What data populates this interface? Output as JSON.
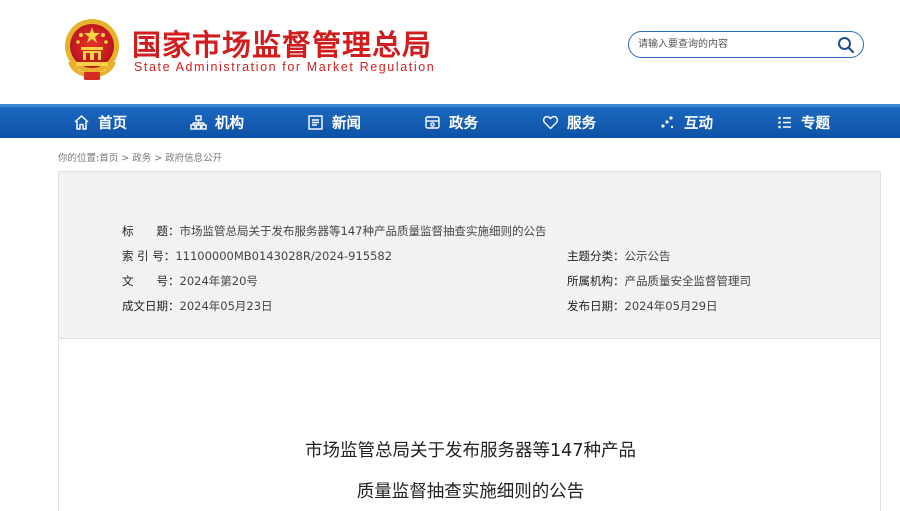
{
  "header": {
    "site_title": "国家市场监督管理总局",
    "site_subtitle": "State Administration for Market Regulation"
  },
  "search": {
    "placeholder": "请输入要查询的内容"
  },
  "nav": {
    "items": [
      {
        "label": "首页",
        "icon": "home-icon"
      },
      {
        "label": "机构",
        "icon": "organization-icon"
      },
      {
        "label": "新闻",
        "icon": "news-icon"
      },
      {
        "label": "政务",
        "icon": "government-affairs-icon"
      },
      {
        "label": "服务",
        "icon": "heart-icon"
      },
      {
        "label": "互动",
        "icon": "interaction-icon"
      },
      {
        "label": "专题",
        "icon": "topic-icon"
      }
    ]
  },
  "breadcrumb": {
    "prefix": "你的位置:",
    "items": [
      "首页",
      "政务",
      "政府信息公开"
    ],
    "separator": ">"
  },
  "info": {
    "title_label": "标　　题：",
    "title_value": "市场监管总局关于发布服务器等147种产品质量监督抽查实施细则的公告",
    "index_label": "索 引 号：",
    "index_value": "11100000MB0143028R/2024-915582",
    "topic_label": "主题分类：",
    "topic_value": "公示公告",
    "doc_label": "文　　号：",
    "doc_value": "2024年第20号",
    "org_label": "所属机构：",
    "org_value": "产品质量安全监督管理司",
    "created_label": "成文日期：",
    "created_value": "2024年05月23日",
    "published_label": "发布日期：",
    "published_value": "2024年05月29日"
  },
  "article": {
    "title_line1": "市场监管总局关于发布服务器等147种产品",
    "title_line2": "质量监督抽查实施细则的公告"
  },
  "colors": {
    "brand_red": "#d01e1e",
    "nav_blue": "#1560b5",
    "panel_gray": "#f2f2f2"
  }
}
